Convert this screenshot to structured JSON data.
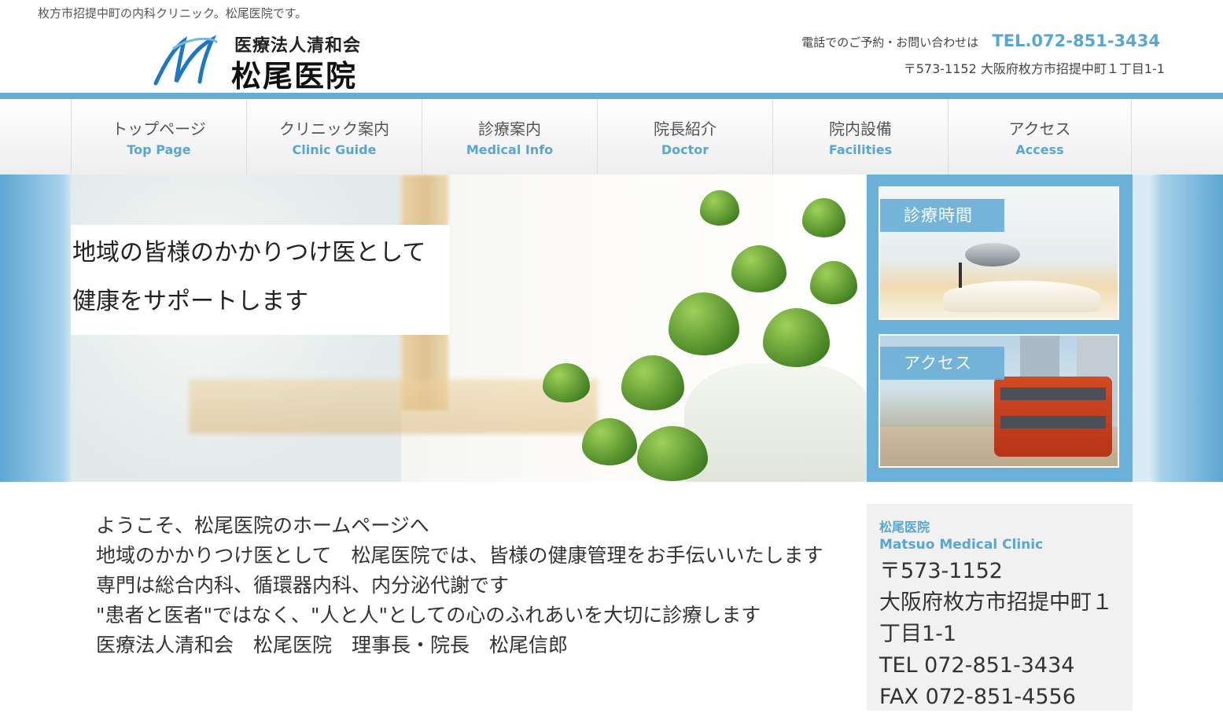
{
  "header": {
    "tagline": "枚方市招提中町の内科クリニック。松尾医院です。",
    "logo_sub": "医療法人清和会",
    "logo_main": "松尾医院",
    "contact_label": "電話でのご予約・お問い合わせは",
    "tel": "TEL.072-851-3434",
    "address": "〒573-1152 大阪府枚方市招提中町１丁目1-1"
  },
  "nav": {
    "items": [
      {
        "jp": "トップページ",
        "en": "Top Page"
      },
      {
        "jp": "クリニック案内",
        "en": "Clinic Guide"
      },
      {
        "jp": "診療案内",
        "en": "Medical Info"
      },
      {
        "jp": "院長紹介",
        "en": "Doctor"
      },
      {
        "jp": "院内設備",
        "en": "Facilities"
      },
      {
        "jp": "アクセス",
        "en": "Access"
      }
    ]
  },
  "hero": {
    "line1": "地域の皆様のかかりつけ医として",
    "line2": "健康をサポートします"
  },
  "banners": {
    "hours": "診療時間",
    "access": "アクセス"
  },
  "welcome": {
    "lines": [
      "ようこそ、松尾医院のホームページへ",
      "地域のかかりつけ医として　松尾医院では、皆様の健康管理をお手伝いいたします",
      "専門は総合内科、循環器内科、内分泌代謝です",
      "\"患者と医者\"ではなく、\"人と人\"としての心のふれあいを大切に診療します",
      "医療法人清和会　松尾医院　理事長・院長　松尾信郎"
    ]
  },
  "info": {
    "name": "松尾医院",
    "name_en": "Matsuo Medical Clinic",
    "postal": "〒573-1152",
    "address": "大阪府枚方市招提中町１丁目1-1",
    "tel": "TEL 072-851-3434",
    "fax": "FAX 072-851-4556"
  },
  "colors": {
    "accent": "#5aa6d2",
    "bar": "#67aed7"
  }
}
